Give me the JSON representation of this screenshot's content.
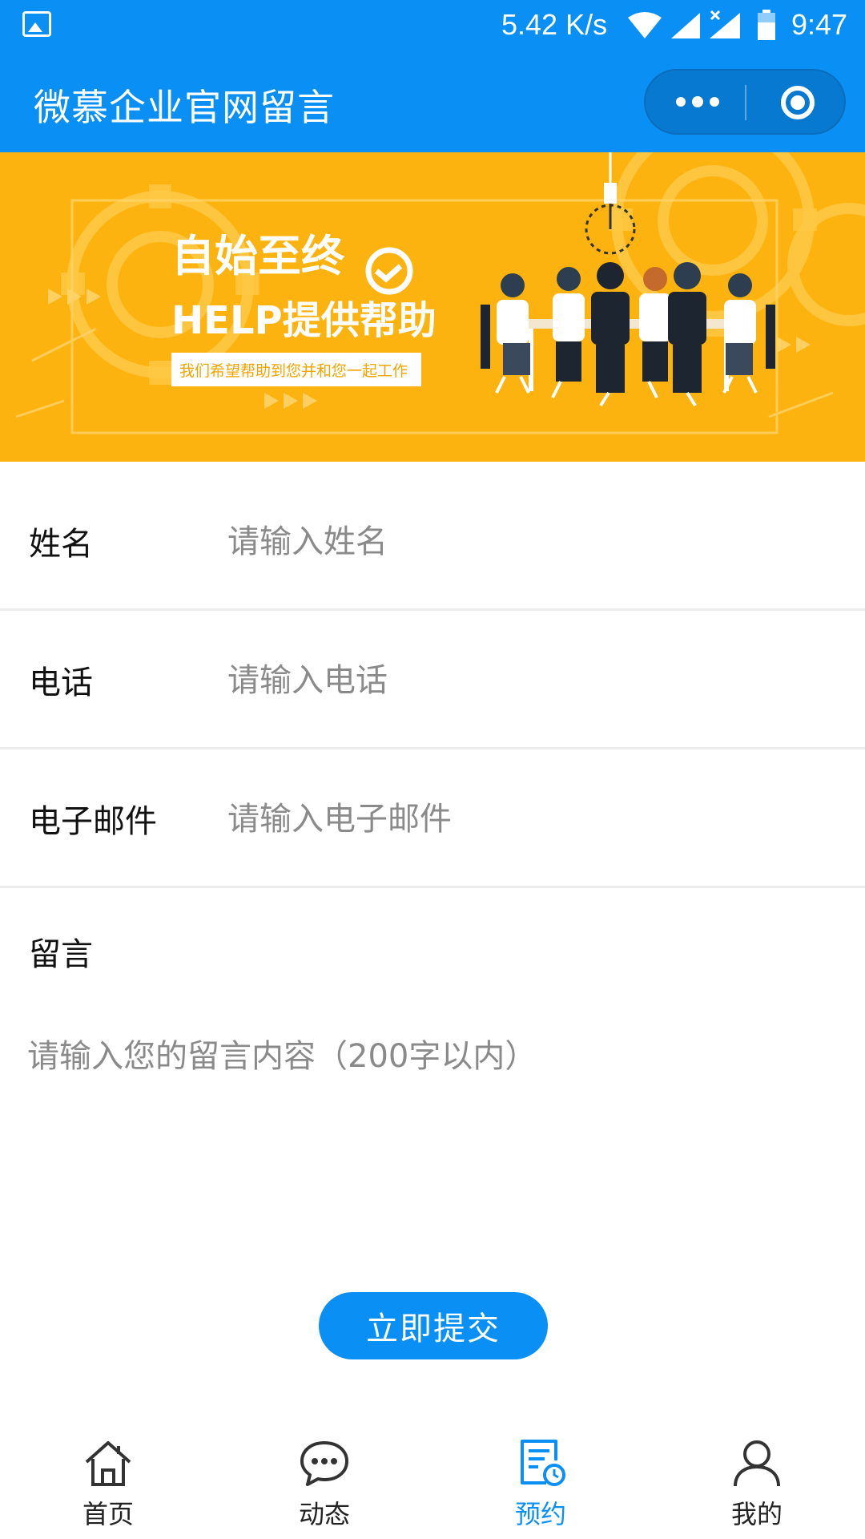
{
  "status_bar": {
    "speed": "5.42 K/s",
    "time": "9:47",
    "icons": [
      "gallery-icon",
      "wifi-icon",
      "signal-icon",
      "signal-off-icon",
      "battery-icon"
    ]
  },
  "title_bar": {
    "title": "微慕企业官网留言",
    "icons": [
      "more-icon",
      "close-mini-program-icon"
    ]
  },
  "banner": {
    "heading": "自始至终",
    "subheading": "HELP提供帮助",
    "tagline": "我们希望帮助到您并和您一起工作"
  },
  "form": {
    "name": {
      "label": "姓名",
      "placeholder": "请输入姓名",
      "value": ""
    },
    "phone": {
      "label": "电话",
      "placeholder": "请输入电话",
      "value": ""
    },
    "email": {
      "label": "电子邮件",
      "placeholder": "请输入电子邮件",
      "value": ""
    },
    "message": {
      "label": "留言",
      "placeholder": "请输入您的留言内容（200字以内）",
      "value": ""
    },
    "submit_label": "立即提交"
  },
  "tabbar": {
    "active": "预约",
    "items": [
      {
        "label": "首页",
        "icon": "home-icon"
      },
      {
        "label": "动态",
        "icon": "chat-bubble-icon"
      },
      {
        "label": "预约",
        "icon": "appointment-calendar-icon"
      },
      {
        "label": "我的",
        "icon": "user-icon"
      }
    ]
  },
  "colors": {
    "primary": "#0a90f4",
    "banner_bg": "#fcb310",
    "placeholder": "#8a8a8a",
    "divider": "#ececec"
  }
}
